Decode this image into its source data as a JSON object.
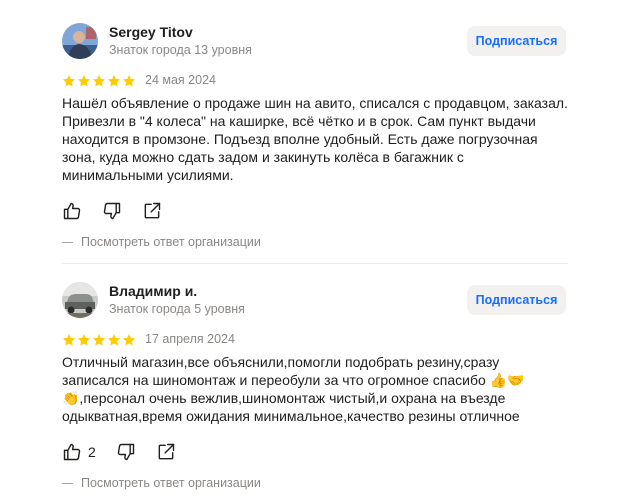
{
  "reviews": [
    {
      "author": "Sergey Titov",
      "badge": "Знаток города 13 уровня",
      "subscribe_label": "Подписаться",
      "rating": 5,
      "date": "24 мая 2024",
      "text": "Нашёл объявление о продаже шин на авито, списался с продавцом, заказал. Привезли в \"4 колеса\" на каширке, всё чётко и в срок. Сам пункт выдачи находится в промзоне. Подъезд вполне удобный. Есть даже погрузочная зона, куда можно сдать задом и закинуть колёса в багажник с минимальными усилиями.",
      "likes": "",
      "org_reply_label": "Посмотреть ответ организации"
    },
    {
      "author": "Владимир и.",
      "badge": "Знаток города 5 уровня",
      "subscribe_label": "Подписаться",
      "rating": 5,
      "date": "17 апреля 2024",
      "text": "Отличный магазин,все объяснили,помогли подобрать резину,сразу записался на шиномонтаж и переобули за что огромное спасибо 👍🤝👏,персонал очень вежлив,шиномонтаж чистый,и охрана на въезде одыкватная,время ожидания минимальное,качество резины отличное",
      "likes": "2",
      "org_reply_label": "Посмотреть ответ организации"
    }
  ],
  "colors": {
    "star": "#fc0",
    "subscribe_text": "#196dff",
    "subscribe_bg": "#f2f1f0",
    "muted": "#8a8784"
  },
  "icons": [
    "thumb-up-icon",
    "thumb-down-icon",
    "share-icon",
    "star-icon"
  ]
}
